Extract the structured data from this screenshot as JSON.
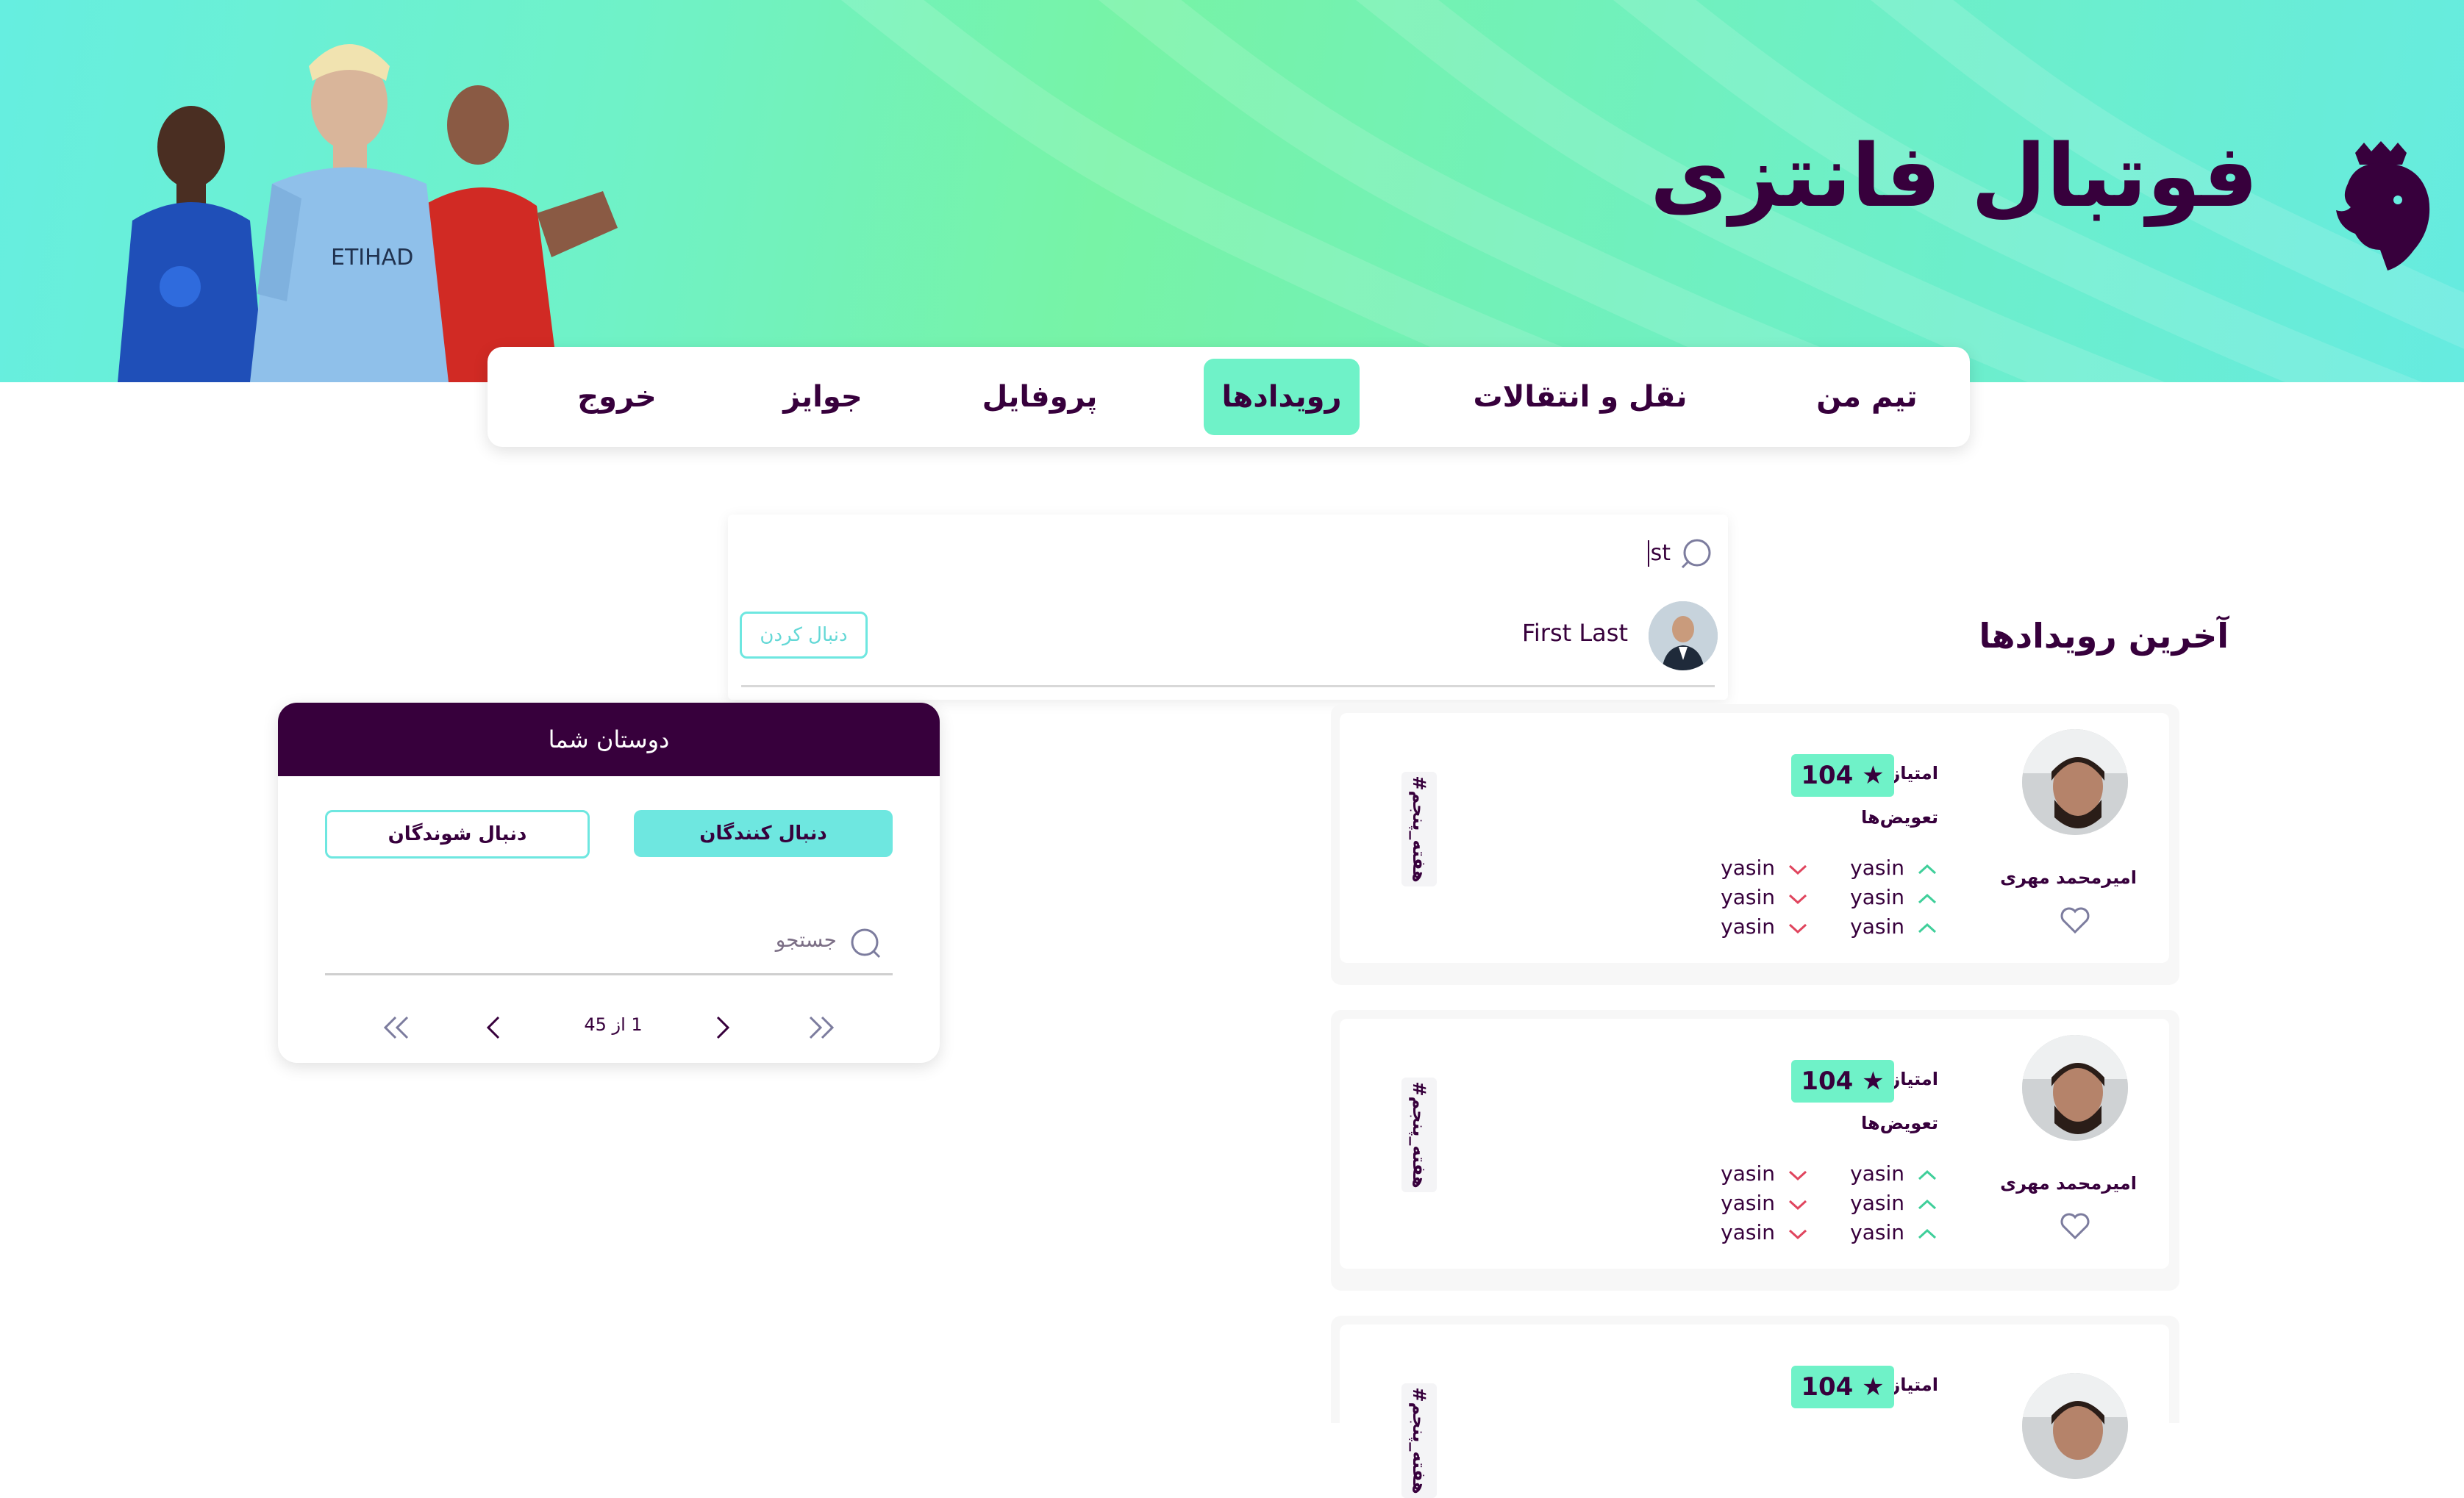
{
  "app": {
    "title": "فوتبال فانتزی",
    "logo_icon": "premier-league-lion-logo",
    "hero_image": "football-players"
  },
  "nav": {
    "items": [
      {
        "label": "تیم من"
      },
      {
        "label": "نقل و انتقالات"
      },
      {
        "label": "رویدادها",
        "active": true
      },
      {
        "label": "پروفایل"
      },
      {
        "label": "جوایز"
      },
      {
        "label": "خروج"
      }
    ]
  },
  "search": {
    "query": "st",
    "icon": "search-icon",
    "result": {
      "name": "First Last",
      "follow_label": "دنبال کردن"
    }
  },
  "friends": {
    "title": "دوستان شما",
    "followers_tab": "دنبال کنندگان",
    "following_tab": "دنبال شوندگان",
    "search_placeholder": "جستجو",
    "pagination": "1 از 45"
  },
  "events": {
    "title": "آخرین رویدادها",
    "items": [
      {
        "user": "امیرمحمد مهری",
        "points_label": "امتیاز هفته",
        "points": "104",
        "subs_label": "تعویض‌ها",
        "tag": "#هفته_پنجم",
        "in": [
          "yasin",
          "yasin",
          "yasin"
        ],
        "out": [
          "yasin",
          "yasin",
          "yasin"
        ]
      },
      {
        "user": "امیرمحمد مهری",
        "points_label": "امتیاز هفته",
        "points": "104",
        "subs_label": "تعویض‌ها",
        "tag": "#هفته_پنجم",
        "in": [
          "yasin",
          "yasin",
          "yasin"
        ],
        "out": [
          "yasin",
          "yasin",
          "yasin"
        ]
      },
      {
        "points_label": "امتیاز هفته",
        "points": "104",
        "tag": "#هفته_پنجم"
      }
    ]
  },
  "colors": {
    "primary": "#37003c",
    "accent": "#6ff2c8",
    "cyan": "#6ee7e0",
    "down": "#e0455e"
  }
}
